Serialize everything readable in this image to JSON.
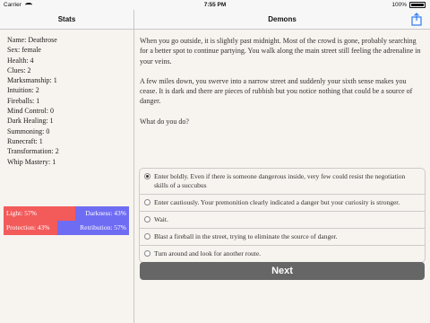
{
  "status_bar": {
    "carrier": "Carrier",
    "time": "7:55 PM",
    "battery": "100%"
  },
  "nav": {
    "left_title": "Stats",
    "right_title": "Demons",
    "accent": "#2f7bf6"
  },
  "stats": [
    "Name: Deathrose",
    "Sex: female",
    "Health: 4",
    "Clues: 2",
    "Marksmanship: 1",
    "Intuition: 2",
    "Fireballs: 1",
    "Mind Control: 0",
    "Dark Healing: 1",
    "Summoning: 0",
    "Runecraft: 1",
    "Transformation: 2",
    "Whip Mastery: 1"
  ],
  "opposed_stats": [
    {
      "left": "Light: 57%",
      "right": "Darkness: 43%",
      "left_fraction": 0.57
    },
    {
      "left": "Protection: 43%",
      "right": "Retribution: 57%",
      "left_fraction": 0.43
    }
  ],
  "bar_colors": {
    "left": "#f35b5b",
    "right": "#6f6cf4"
  },
  "story": [
    "When you go outside, it is slightly past midnight. Most of the crowd is gone, probably searching for a better spot to continue partying. You walk along the main street still feeling the adrenaline in your veins.",
    "A few miles down, you swerve into a narrow street and suddenly your sixth sense makes you cease. It is dark and there are pieces of rubbish but you notice nothing that could be a source of danger.",
    "What do you do?"
  ],
  "choices": [
    {
      "label": "Enter boldly. Even if there is someone dangerous inside, very few could resist the negotiation skills of a succubus",
      "selected": true
    },
    {
      "label": "Enter cautiously. Your premonition clearly indicated a danger but your curiosity is stronger.",
      "selected": false
    },
    {
      "label": "Wait.",
      "selected": false
    },
    {
      "label": "Blast a fireball in the street, trying to eliminate the source of danger.",
      "selected": false
    },
    {
      "label": "Turn around and look for another route.",
      "selected": false
    }
  ],
  "next_label": "Next",
  "icons": {
    "share": "share-icon",
    "wifi": "wifi-icon",
    "battery": "battery-icon",
    "radio": "radio-button-icon"
  }
}
